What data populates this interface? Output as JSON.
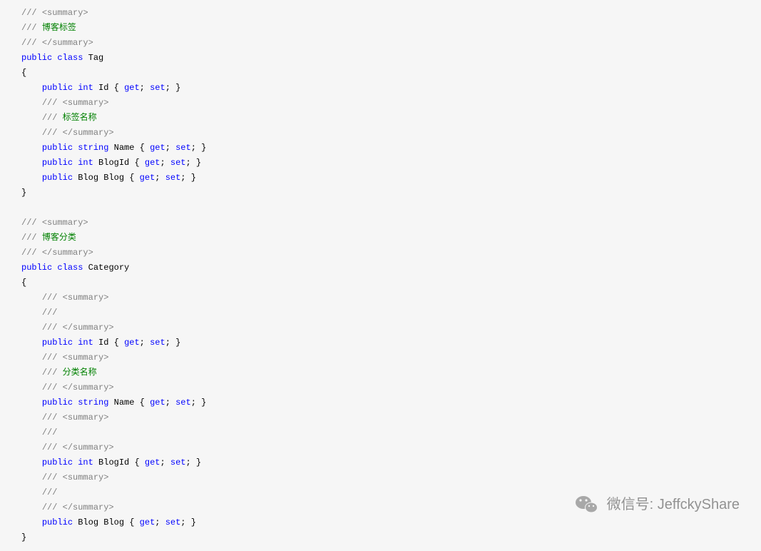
{
  "code": {
    "slashes": "///",
    "summaryOpen": "<summary>",
    "summaryClose": "</summary>",
    "tagComment": "博客标签",
    "categoryComment": "博客分类",
    "subTagName": "标签名称",
    "subCategoryName": "分类名称",
    "public": "public",
    "class": "class",
    "int": "int",
    "string": "string",
    "tagClass": "Tag",
    "categoryClass": "Category",
    "propId": "Id",
    "propName": "Name",
    "propBlogId": "BlogId",
    "propBlogType": "Blog",
    "propBlog": "Blog",
    "braceOpen": "{",
    "braceClose": "}",
    "get": "get",
    "set": "set",
    "semi": ";",
    "spaceBraceOpen": " { ",
    "spaceBraceClose": " }",
    "semiSpace": "; "
  },
  "watermark": {
    "label": "微信号: JeffckyShare"
  }
}
